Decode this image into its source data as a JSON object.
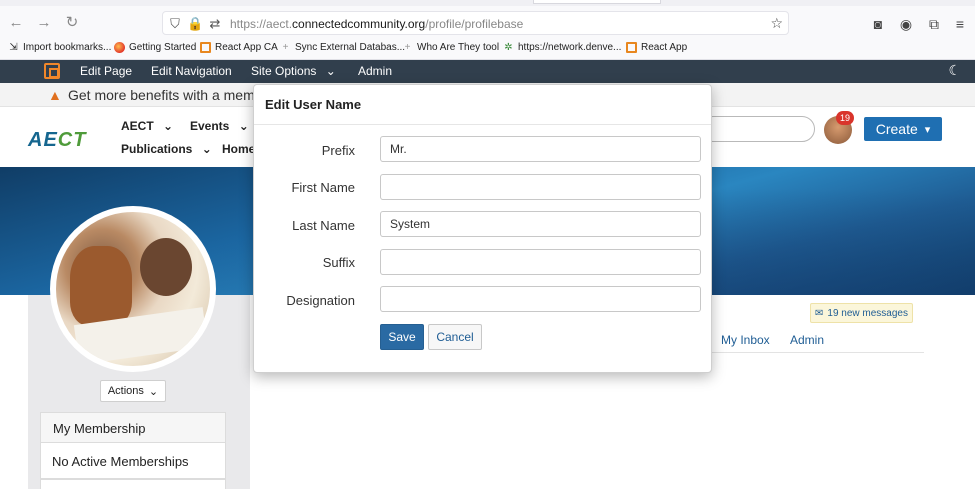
{
  "browser": {
    "url_prefix": "https://aect.",
    "url_host": "connectedcommunity.org",
    "url_path": "/profile/profilebase",
    "icons": {
      "back": "←",
      "forward": "→",
      "reload": "↻",
      "shield": "⛉",
      "lock": "🔒",
      "permissions": "⇄",
      "star": "☆",
      "pocket": "◙",
      "account": "◉",
      "extensions": "⧉",
      "menu": "≡"
    },
    "bookmarks": [
      {
        "label": "Import bookmarks...",
        "icon": "import-icon"
      },
      {
        "label": "Getting Started",
        "icon": "firefox-icon"
      },
      {
        "label": "React App CA",
        "icon": "react-app-icon"
      },
      {
        "label": "Sync External Databas...",
        "icon": "plus-icon"
      },
      {
        "label": "Who Are They tool",
        "icon": "plus-icon"
      },
      {
        "label": "https://network.denve...",
        "icon": "network-icon"
      },
      {
        "label": "React App",
        "icon": "react-app-icon"
      }
    ]
  },
  "admin_bar": {
    "items": [
      "Edit Page",
      "Edit Navigation",
      "Site Options",
      "Admin"
    ],
    "site_options_caret": "⌄",
    "moon": "☾"
  },
  "notice": {
    "icon": "▲",
    "text": "Get more benefits with a membe"
  },
  "site": {
    "logo_a": "AE",
    "logo_b": "CT",
    "nav": {
      "aect": "AECT",
      "events": "Events",
      "publications": "Publications",
      "home": "Home",
      "caret": "⌄"
    },
    "notification_count": "19",
    "create_label": "Create",
    "create_caret": "▾"
  },
  "profile": {
    "actions_label": "Actions",
    "actions_caret": "⌄",
    "membership_title": "My Membership",
    "membership_status": "No Active Memberships",
    "messages_icon": "✉",
    "messages_label": "19 new messages",
    "tabs": [
      "My Inbox",
      "Admin"
    ]
  },
  "modal": {
    "title": "Edit User Name",
    "fields": [
      {
        "label": "Prefix",
        "value": "Mr.",
        "placeholder": ""
      },
      {
        "label": "First Name",
        "value": "",
        "placeholder": ""
      },
      {
        "label": "Last Name",
        "value": "System",
        "placeholder": ""
      },
      {
        "label": "Suffix",
        "value": "",
        "placeholder": ""
      },
      {
        "label": "Designation",
        "value": "",
        "placeholder": ""
      }
    ],
    "save_label": "Save",
    "cancel_label": "Cancel"
  },
  "colors": {
    "admin_bar": "#313f4d",
    "brand_blue": "#1f6fb2",
    "save_button": "#2a6aa3",
    "badge": "#d9342b",
    "warning": "#e0701e"
  }
}
